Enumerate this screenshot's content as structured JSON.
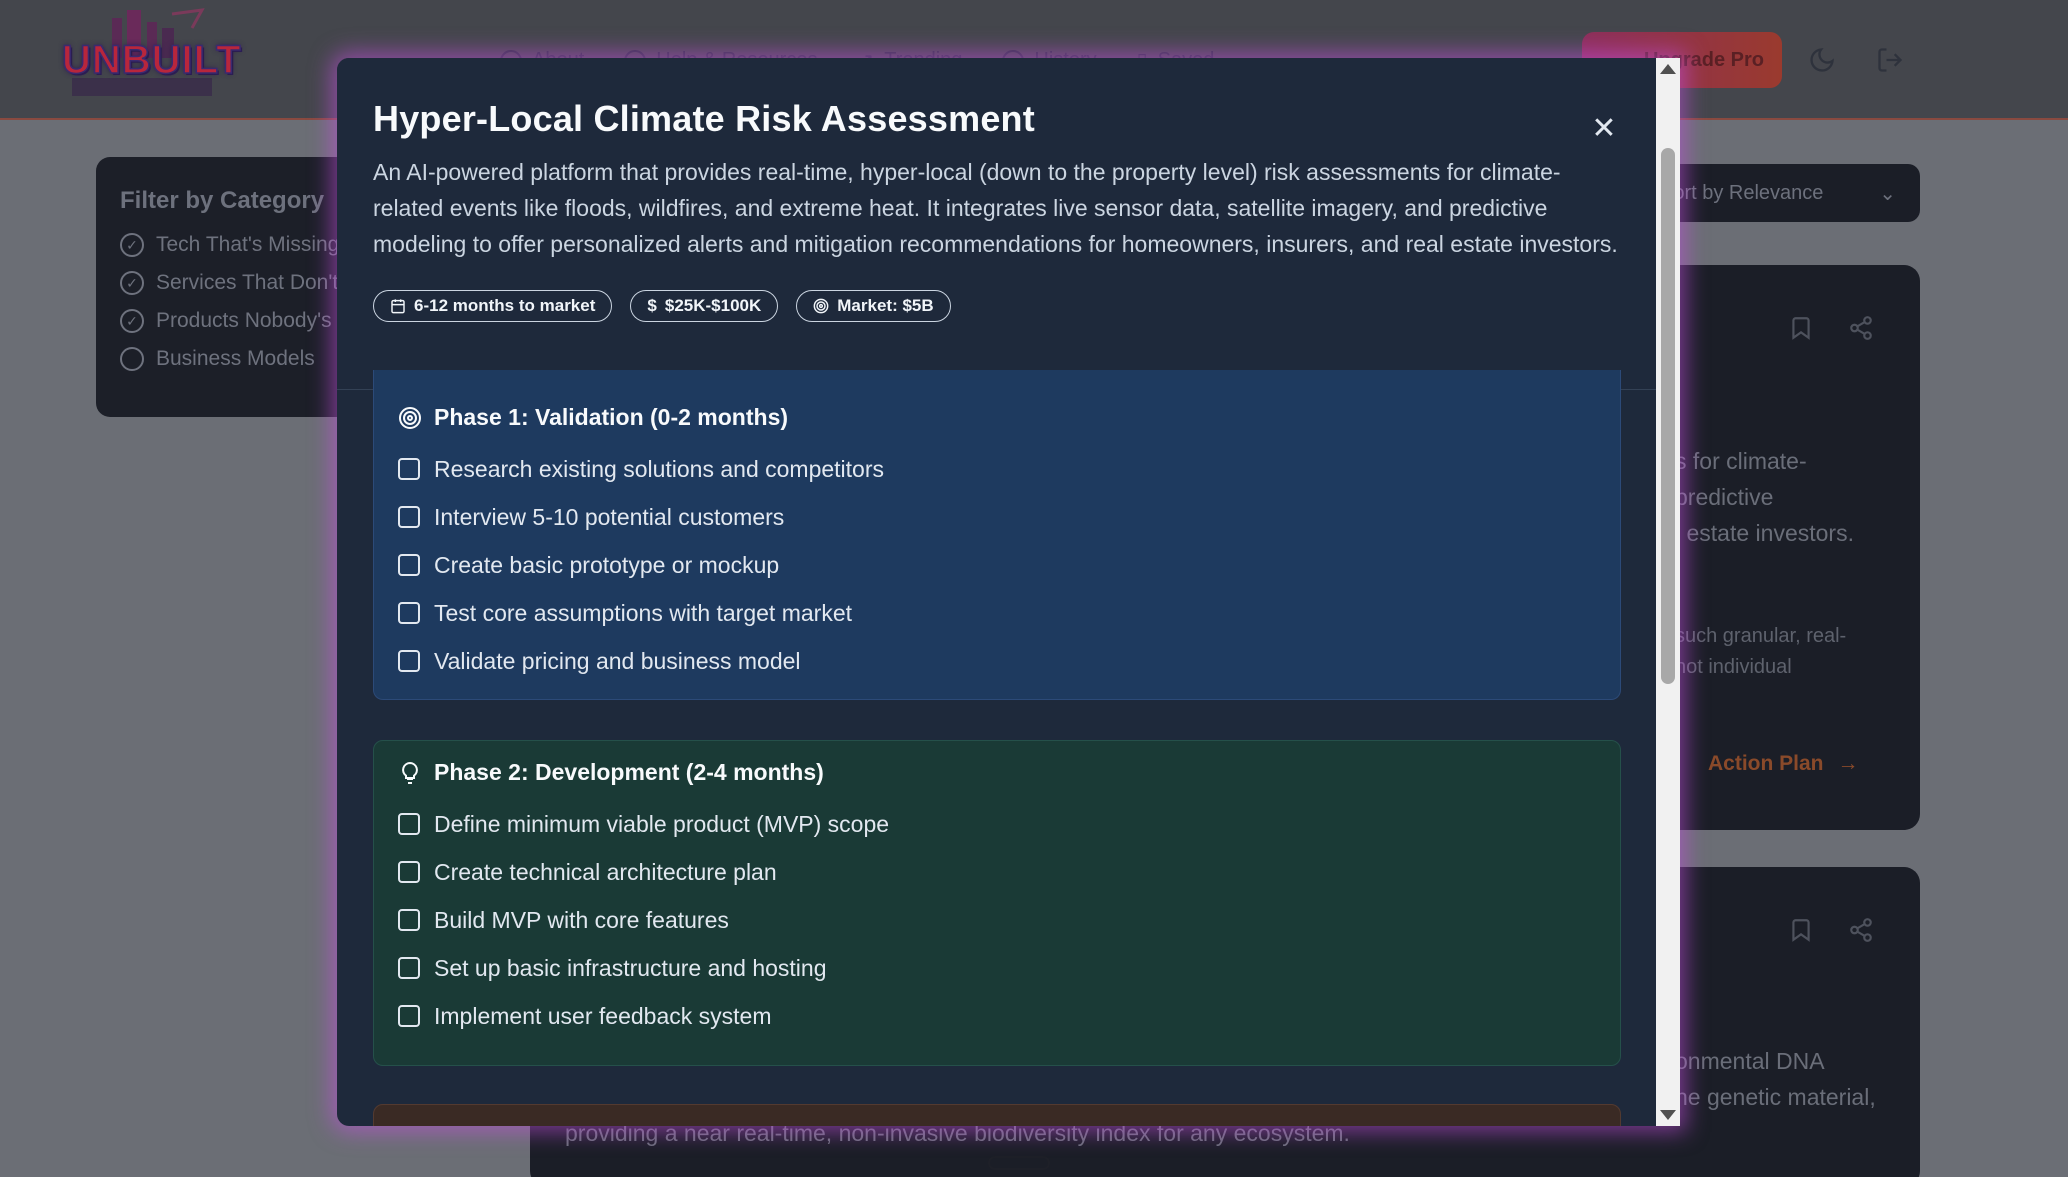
{
  "app": {
    "logo_text": "UNBUILT",
    "nav": [
      "About",
      "Help & Resources",
      "Trending",
      "History",
      "Saved"
    ],
    "upgrade_label": "Upgrade Pro"
  },
  "sidebar": {
    "title": "Filter by Category",
    "items": [
      {
        "label": "Tech That's Missing",
        "checked": true
      },
      {
        "label": "Services That Don't Exist",
        "checked": true
      },
      {
        "label": "Products Nobody's Built",
        "checked": true
      },
      {
        "label": "Business Models",
        "checked": false
      }
    ]
  },
  "sort": {
    "label": "Sort by Relevance"
  },
  "background_cards": {
    "card1_text": [
      "s for climate-",
      "predictive",
      "l estate investors."
    ],
    "card1_small": [
      "such granular, real-",
      "not individual"
    ],
    "card1_action": "Action Plan",
    "card2_text": [
      "onmental DNA",
      "he genetic material,"
    ],
    "card2_bottom": "providing a near real-time, non-invasive biodiversity index for any ecosystem."
  },
  "modal": {
    "title": "Hyper-Local Climate Risk Assessment",
    "description": "An AI-powered platform that provides real-time, hyper-local (down to the property level) risk assessments for climate-related events like floods, wildfires, and extreme heat. It integrates live sensor data, satellite imagery, and predictive modeling to offer personalized alerts and mitigation recommendations for homeowners, insurers, and real estate investors.",
    "badges": {
      "time": "6-12 months to market",
      "cost": "$25K-$100K",
      "market": "Market: $5B"
    },
    "close_symbol": "✕"
  },
  "phases": [
    {
      "title": "Phase 1: Validation (0-2 months)",
      "icon": "target-icon",
      "color": "#1e3a5f",
      "tasks": [
        "Research existing solutions and competitors",
        "Interview 5-10 potential customers",
        "Create basic prototype or mockup",
        "Test core assumptions with target market",
        "Validate pricing and business model"
      ]
    },
    {
      "title": "Phase 2: Development (2-4 months)",
      "icon": "lightbulb-icon",
      "color": "#1a3a36",
      "tasks": [
        "Define minimum viable product (MVP) scope",
        "Create technical architecture plan",
        "Build MVP with core features",
        "Set up basic infrastructure and hosting",
        "Implement user feedback system"
      ]
    }
  ]
}
